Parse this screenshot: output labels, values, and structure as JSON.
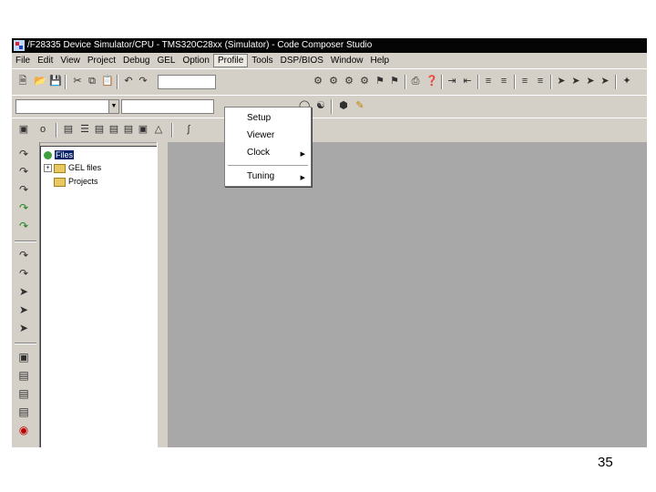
{
  "window": {
    "title": "/F28335 Device Simulator/CPU - TMS320C28xx (Simulator) - Code Composer Studio"
  },
  "menubar": {
    "items": [
      "File",
      "Edit",
      "View",
      "Project",
      "Debug",
      "GEL",
      "Option",
      "Profile",
      "Tools",
      "DSP/BIOS",
      "Window",
      "Help"
    ],
    "active": "Profile"
  },
  "profile_menu": {
    "items": [
      {
        "label": "Setup",
        "submenu": false
      },
      {
        "label": "Viewer",
        "submenu": false
      },
      {
        "label": "Clock",
        "submenu": true
      },
      {
        "label": "Tuning",
        "submenu": true
      }
    ]
  },
  "project_tree": {
    "root": "Files",
    "children": [
      "GEL files",
      "Projects"
    ]
  },
  "page": {
    "number": "35"
  }
}
